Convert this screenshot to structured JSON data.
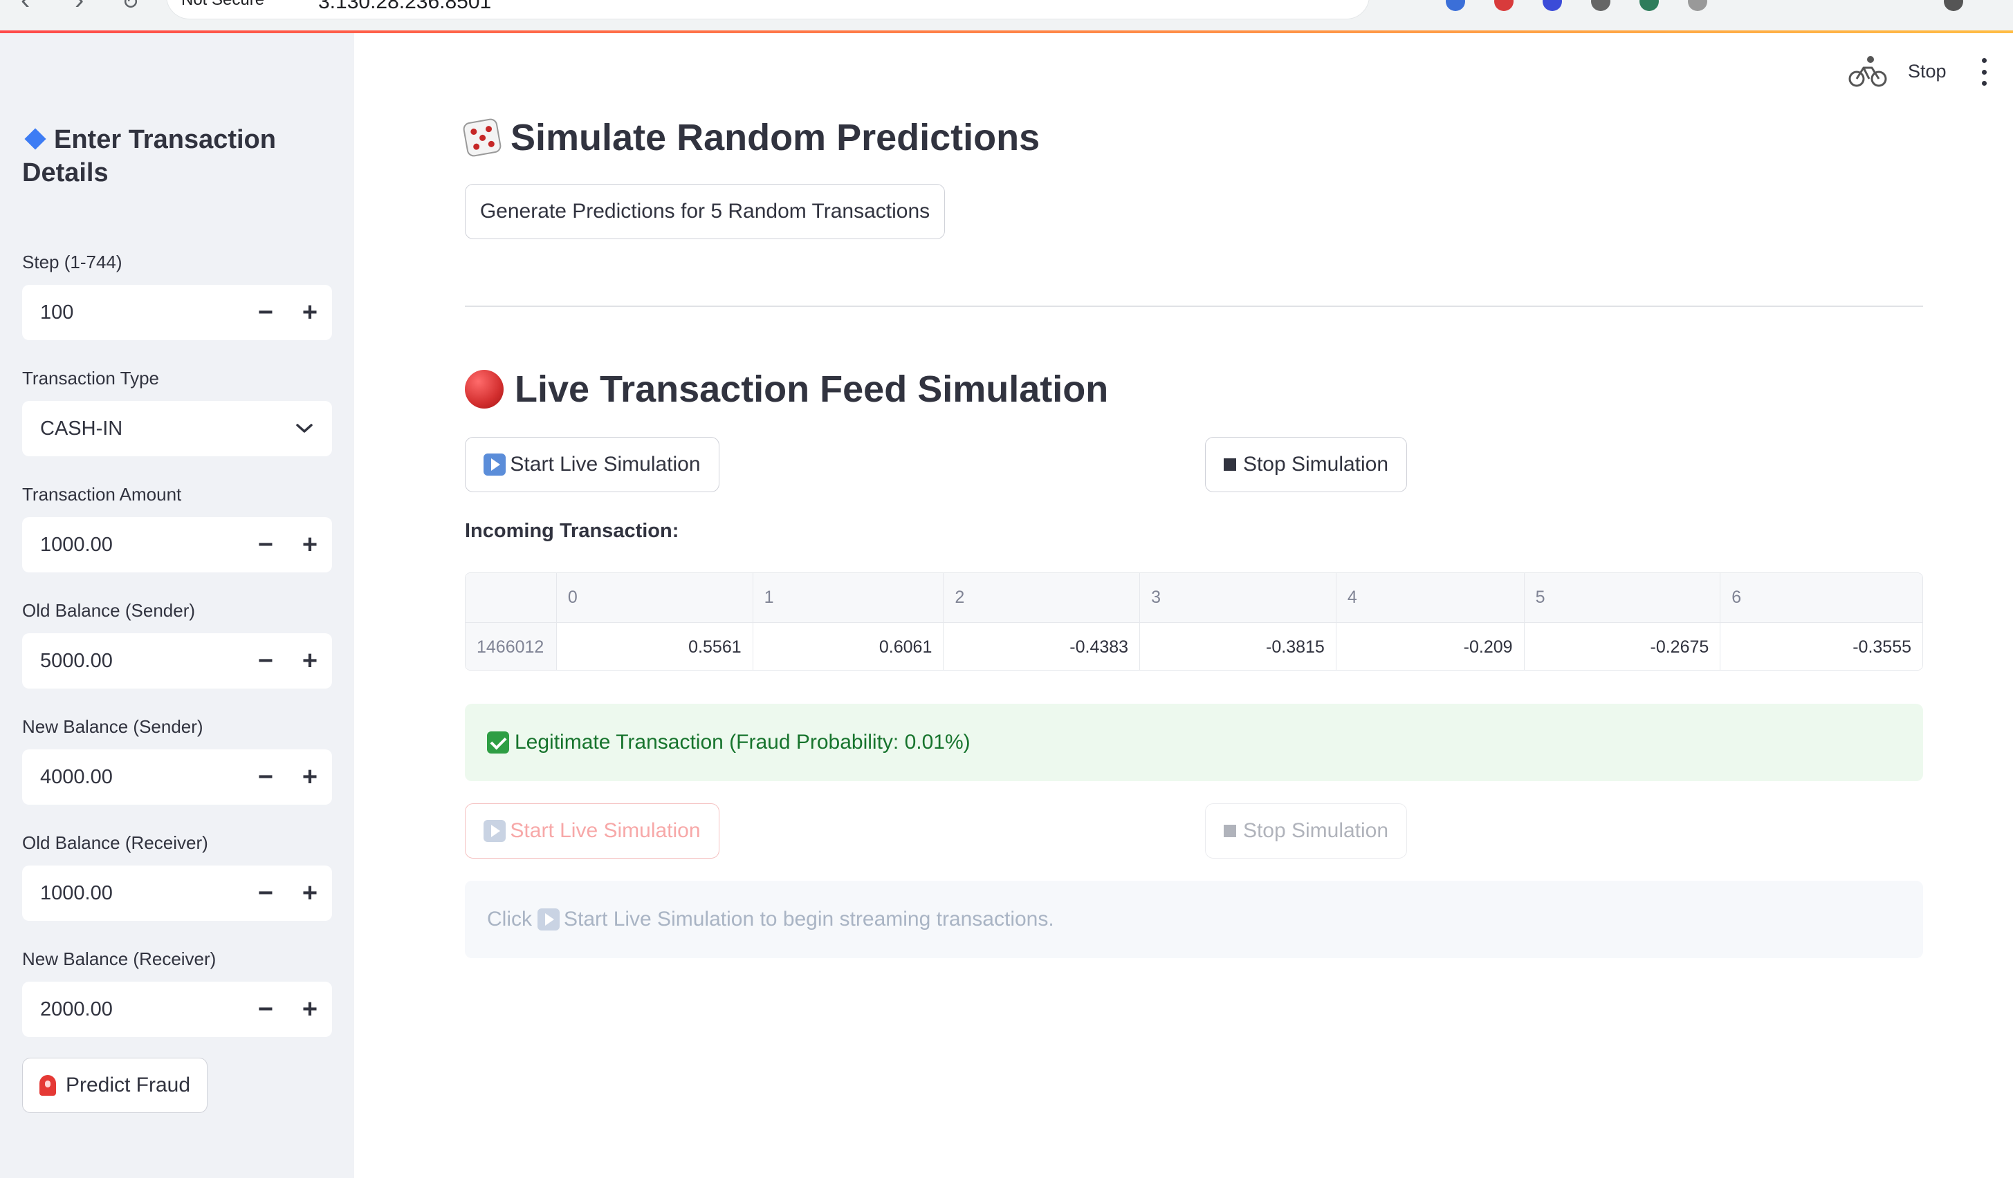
{
  "browser": {
    "security_label": "Not Secure",
    "url": "3.130.28.236:8501"
  },
  "header": {
    "stop_label": "Stop"
  },
  "sidebar": {
    "title": "Enter Transaction Details",
    "fields": [
      {
        "label": "Step (1-744)",
        "value": "100",
        "type": "number"
      },
      {
        "label": "Transaction Type",
        "value": "CASH-IN",
        "type": "select"
      },
      {
        "label": "Transaction Amount",
        "value": "1000.00",
        "type": "number"
      },
      {
        "label": "Old Balance (Sender)",
        "value": "5000.00",
        "type": "number"
      },
      {
        "label": "New Balance (Sender)",
        "value": "4000.00",
        "type": "number"
      },
      {
        "label": "Old Balance (Receiver)",
        "value": "1000.00",
        "type": "number"
      },
      {
        "label": "New Balance (Receiver)",
        "value": "2000.00",
        "type": "number"
      }
    ],
    "predict_button": "Predict Fraud"
  },
  "main": {
    "random_section": {
      "title": "Simulate Random Predictions",
      "button": "Generate Predictions for 5 Random Transactions"
    },
    "live_section": {
      "title": "Live Transaction Feed Simulation",
      "start_button": "Start Live Simulation",
      "stop_button": "Stop Simulation",
      "incoming_label": "Incoming Transaction:",
      "table": {
        "columns": [
          "",
          "0",
          "1",
          "2",
          "3",
          "4",
          "5",
          "6"
        ],
        "row_index": "1466012",
        "values": [
          "0.5561",
          "0.6061",
          "-0.4383",
          "-0.3815",
          "-0.209",
          "-0.2675",
          "-0.3555"
        ]
      },
      "result_message": "Legitimate Transaction (Fraud Probability: 0.01%)",
      "start_button_2": "Start Live Simulation",
      "stop_button_2": "Stop Simulation",
      "info_prefix": "Click",
      "info_suffix": "Start Live Simulation to begin streaming transactions."
    }
  },
  "colors": {
    "sidebar_bg": "#f0f2f6",
    "accent_red": "#ff4b4b",
    "success_bg": "#edf9ee",
    "success_text": "#17742d"
  }
}
